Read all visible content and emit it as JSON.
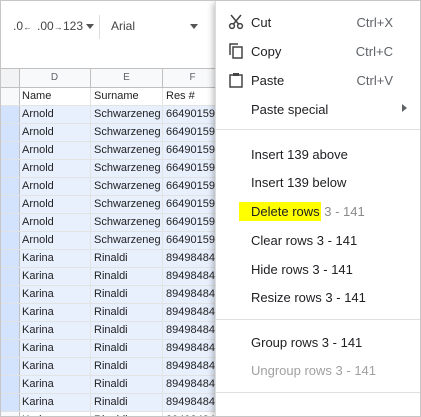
{
  "toolbar": {
    "dec_decrease": ".0",
    "dec_increase": ".00",
    "more_formats": "123",
    "font": "Arial"
  },
  "grid": {
    "columns": [
      "D",
      "E",
      "F"
    ],
    "rows": [
      {
        "d": "Name",
        "e": "Surname",
        "f": "Res #",
        "selected": false
      },
      {
        "d": "Arnold",
        "e": "Schwarzeneg",
        "f": "66490159",
        "selected": true
      },
      {
        "d": "Arnold",
        "e": "Schwarzeneg",
        "f": "66490159",
        "selected": true
      },
      {
        "d": "Arnold",
        "e": "Schwarzeneg",
        "f": "66490159",
        "selected": true
      },
      {
        "d": "Arnold",
        "e": "Schwarzeneg",
        "f": "66490159",
        "selected": true
      },
      {
        "d": "Arnold",
        "e": "Schwarzeneg",
        "f": "66490159",
        "selected": true
      },
      {
        "d": "Arnold",
        "e": "Schwarzeneg",
        "f": "66490159",
        "selected": true
      },
      {
        "d": "Arnold",
        "e": "Schwarzeneg",
        "f": "66490159",
        "selected": true
      },
      {
        "d": "Arnold",
        "e": "Schwarzeneg",
        "f": "66490159",
        "selected": true
      },
      {
        "d": "Karina",
        "e": "Rinaldi",
        "f": "89498484",
        "selected": true
      },
      {
        "d": "Karina",
        "e": "Rinaldi",
        "f": "89498484",
        "selected": true
      },
      {
        "d": "Karina",
        "e": "Rinaldi",
        "f": "89498484",
        "selected": true
      },
      {
        "d": "Karina",
        "e": "Rinaldi",
        "f": "89498484",
        "selected": true
      },
      {
        "d": "Karina",
        "e": "Rinaldi",
        "f": "89498484",
        "selected": true
      },
      {
        "d": "Karina",
        "e": "Rinaldi",
        "f": "89498484",
        "selected": true
      },
      {
        "d": "Karina",
        "e": "Rinaldi",
        "f": "89498484",
        "selected": true
      },
      {
        "d": "Karina",
        "e": "Rinaldi",
        "f": "89498484",
        "selected": true
      },
      {
        "d": "Karina",
        "e": "Rinaldi",
        "f": "89498484",
        "selected": true
      },
      {
        "d": "Karina",
        "e": "Rinaldi",
        "f": "89498484",
        "selected": false
      }
    ]
  },
  "menu": {
    "cut": {
      "label": "Cut",
      "shortcut": "Ctrl+X",
      "icon": "scissors-icon"
    },
    "copy": {
      "label": "Copy",
      "shortcut": "Ctrl+C",
      "icon": "copy-icon"
    },
    "paste": {
      "label": "Paste",
      "shortcut": "Ctrl+V",
      "icon": "clipboard-icon"
    },
    "paste_special": {
      "label": "Paste special"
    },
    "insert_above": {
      "label": "Insert 139 above"
    },
    "insert_below": {
      "label": "Insert 139 below"
    },
    "delete_rows": {
      "label": "Delete rows",
      "suffix": "3 - 141"
    },
    "clear_rows": {
      "label": "Clear rows 3 - 141"
    },
    "hide_rows": {
      "label": "Hide rows 3 - 141"
    },
    "resize_rows": {
      "label": "Resize rows 3 - 141"
    },
    "group_rows": {
      "label": "Group rows 3 - 141"
    },
    "ungroup_rows": {
      "label": "Ungroup rows 3 - 141"
    }
  },
  "colors": {
    "selection": "#e8f0fe",
    "highlight": "#ffff00"
  }
}
